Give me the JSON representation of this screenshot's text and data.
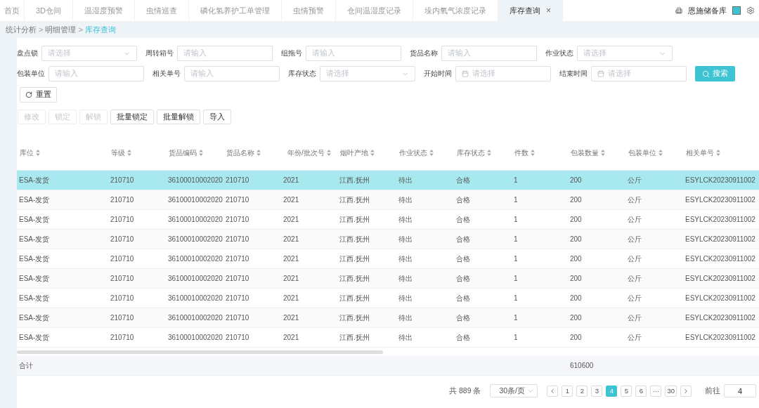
{
  "tabs": [
    {
      "label": "首页",
      "selected": false
    },
    {
      "label": "3D仓间",
      "selected": false
    },
    {
      "label": "温湿度预警",
      "selected": false
    },
    {
      "label": "虫情巡查",
      "selected": false
    },
    {
      "label": "磷化氢养护工单管理",
      "selected": false
    },
    {
      "label": "虫情预警",
      "selected": false
    },
    {
      "label": "仓间温湿度记录",
      "selected": false
    },
    {
      "label": "垛内氧气浓度记录",
      "selected": false
    },
    {
      "label": "库存查询",
      "selected": true,
      "close": "×"
    }
  ],
  "header": {
    "warehouse": "恩施储备库"
  },
  "breadcrumb": [
    {
      "label": "统计分析",
      "current": false
    },
    {
      "label": "明细管理",
      "current": false
    },
    {
      "label": "库存查询",
      "current": true
    }
  ],
  "breadcrumb_separator": ">",
  "filters": [
    [
      {
        "label": "盘点锁",
        "kind": "select",
        "placeholder": "请选择"
      },
      {
        "label": "周转箱号",
        "kind": "input",
        "placeholder": "请输入"
      },
      {
        "label": "组拖号",
        "kind": "input",
        "placeholder": "请输入"
      },
      {
        "label": "货品名称",
        "kind": "input",
        "placeholder": "请输入"
      },
      {
        "label": "作业状态",
        "kind": "select",
        "placeholder": "请选择"
      }
    ],
    [
      {
        "label": "包装单位",
        "kind": "input",
        "placeholder": "请输入"
      },
      {
        "label": "相关单号",
        "kind": "input",
        "placeholder": "请输入"
      },
      {
        "label": "库存状态",
        "kind": "select",
        "placeholder": "请选择"
      },
      {
        "label": "开始时间",
        "kind": "date",
        "placeholder": "请选择"
      },
      {
        "label": "结束时间",
        "kind": "date",
        "placeholder": "请选择"
      }
    ]
  ],
  "search_button": "搜索",
  "reset_button": "重置",
  "actions": [
    {
      "label": "修改",
      "disabled": true
    },
    {
      "label": "锁定",
      "disabled": true
    },
    {
      "label": "解锁",
      "disabled": true
    },
    {
      "label": "批量锁定",
      "disabled": false
    },
    {
      "label": "批量解锁",
      "disabled": false
    },
    {
      "label": "导入",
      "disabled": false
    }
  ],
  "table": {
    "columns": [
      {
        "label": "库位"
      },
      {
        "label": "等级"
      },
      {
        "label": "货品编码"
      },
      {
        "label": "货品名称"
      },
      {
        "label": "年份/批次号"
      },
      {
        "label": "烟叶产地"
      },
      {
        "label": "作业状态"
      },
      {
        "label": "库存状态"
      },
      {
        "label": "件数"
      },
      {
        "label": "包装数量",
        "total": "610600"
      },
      {
        "label": "包装单位"
      },
      {
        "label": "相关单号"
      }
    ],
    "rows": [
      {
        "selected": true,
        "cells": [
          "ESA-发货",
          "210710",
          "36100010002020",
          "210710",
          "2021",
          "江西.抚州",
          "待出",
          "合格",
          "1",
          "200",
          "公斤",
          "ESYLCK20230911002"
        ]
      },
      {
        "selected": false,
        "cells": [
          "ESA-发货",
          "210710",
          "36100010002020",
          "210710",
          "2021",
          "江西.抚州",
          "待出",
          "合格",
          "1",
          "200",
          "公斤",
          "ESYLCK20230911002"
        ]
      },
      {
        "selected": false,
        "cells": [
          "ESA-发货",
          "210710",
          "36100010002020",
          "210710",
          "2021",
          "江西.抚州",
          "待出",
          "合格",
          "1",
          "200",
          "公斤",
          "ESYLCK20230911002"
        ]
      },
      {
        "selected": false,
        "cells": [
          "ESA-发货",
          "210710",
          "36100010002020",
          "210710",
          "2021",
          "江西.抚州",
          "待出",
          "合格",
          "1",
          "200",
          "公斤",
          "ESYLCK20230911002"
        ]
      },
      {
        "selected": false,
        "cells": [
          "ESA-发货",
          "210710",
          "36100010002020",
          "210710",
          "2021",
          "江西.抚州",
          "待出",
          "合格",
          "1",
          "200",
          "公斤",
          "ESYLCK20230911002"
        ]
      },
      {
        "selected": false,
        "cells": [
          "ESA-发货",
          "210710",
          "36100010002020",
          "210710",
          "2021",
          "江西.抚州",
          "待出",
          "合格",
          "1",
          "200",
          "公斤",
          "ESYLCK20230911002"
        ]
      },
      {
        "selected": false,
        "cells": [
          "ESA-发货",
          "210710",
          "36100010002020",
          "210710",
          "2021",
          "江西.抚州",
          "待出",
          "合格",
          "1",
          "200",
          "公斤",
          "ESYLCK20230911002"
        ]
      },
      {
        "selected": false,
        "cells": [
          "ESA-发货",
          "210710",
          "36100010002020",
          "210710",
          "2021",
          "江西.抚州",
          "待出",
          "合格",
          "1",
          "200",
          "公斤",
          "ESYLCK20230911002"
        ]
      },
      {
        "selected": false,
        "cells": [
          "ESA-发货",
          "210710",
          "36100010002020",
          "210710",
          "2021",
          "江西.抚州",
          "待出",
          "合格",
          "1",
          "200",
          "公斤",
          "ESYLCK20230911002"
        ]
      }
    ],
    "total_label": "合计"
  },
  "pagination": {
    "total": "共 889 条",
    "page_size": "30条/页",
    "pages": [
      {
        "label": "1",
        "selected": false
      },
      {
        "label": "2",
        "selected": false
      },
      {
        "label": "3",
        "selected": false
      },
      {
        "label": "4",
        "selected": true
      },
      {
        "label": "5",
        "selected": false
      },
      {
        "label": "6",
        "selected": false
      },
      {
        "label": "···",
        "selected": false
      },
      {
        "label": "30",
        "selected": false
      }
    ],
    "goto_label": "前往",
    "goto_value": "4"
  }
}
